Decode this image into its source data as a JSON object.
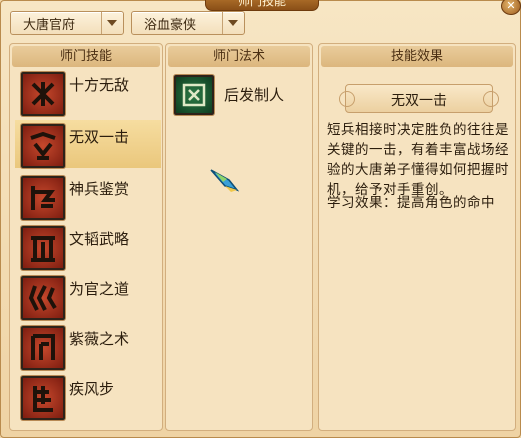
{
  "window": {
    "title": "师门技能"
  },
  "filters": {
    "school": "大唐官府",
    "faction": "浴血豪侠"
  },
  "skills_panel": {
    "header": "师门技能",
    "items": [
      {
        "label": "十方无敌"
      },
      {
        "label": "无双一击"
      },
      {
        "label": "神兵鉴赏"
      },
      {
        "label": "文韬武略"
      },
      {
        "label": "为官之道"
      },
      {
        "label": "紫薇之术"
      },
      {
        "label": "疾风步"
      }
    ],
    "selected_index": 1
  },
  "arts_panel": {
    "header": "师门法术",
    "items": [
      {
        "label": "后发制人"
      }
    ]
  },
  "effect_panel": {
    "header": "技能效果",
    "skill_name": "无双一击",
    "description": "短兵相接时决定胜负的往往是关键的一击，有着丰富战场经验的大唐弟子懂得如何把握时机，给予对手重创。",
    "learn_effect": "学习效果：提高角色的命中"
  },
  "colors": {
    "accent": "#b6762e",
    "selected_row": "#eac77c",
    "skill_icon": "#c6482c",
    "art_icon": "#2d7a45"
  }
}
